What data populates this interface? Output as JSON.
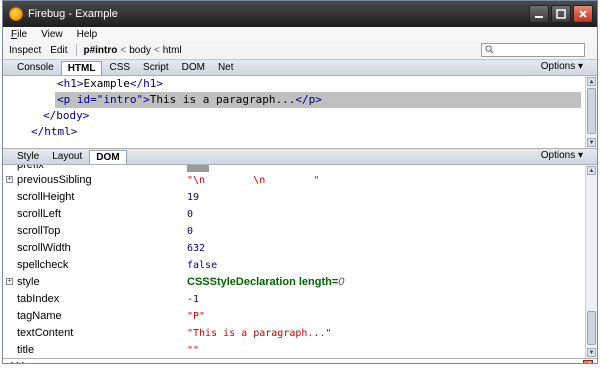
{
  "window": {
    "title": "Firebug - Example"
  },
  "menu": {
    "items": [
      {
        "label": "File",
        "accel": "F",
        "rest": "ile"
      },
      {
        "label": "View",
        "accel": "",
        "rest": "View"
      },
      {
        "label": "Help",
        "accel": "",
        "rest": "Help"
      }
    ]
  },
  "toolbar": {
    "inspect": "Inspect",
    "edit": "Edit",
    "breadcrumb": [
      "p#intro",
      "body",
      "html"
    ],
    "crumb_sep": "<"
  },
  "main_tabs": [
    "Console",
    "HTML",
    "CSS",
    "Script",
    "DOM",
    "Net"
  ],
  "main_active_tab": "HTML",
  "options_label": "Options ▾",
  "html_source": {
    "h1_open": "<h1>",
    "h1_text": "Example",
    "h1_close": "</h1>",
    "p_open": "<p id=\"intro\">",
    "p_text": "This is a paragraph...",
    "p_close": "</p>",
    "body_close": "</body>",
    "html_close": "</html>"
  },
  "side_tabs": [
    "Style",
    "Layout",
    "DOM"
  ],
  "side_active_tab": "DOM",
  "dom_rows": [
    {
      "name": "prefix",
      "value": "",
      "kind": "badge",
      "expandable": false
    },
    {
      "name": "previousSibling",
      "value": "\"\\n        \\n        \"",
      "kind": "str",
      "expandable": true
    },
    {
      "name": "scrollHeight",
      "value": "19",
      "kind": "num",
      "expandable": false
    },
    {
      "name": "scrollLeft",
      "value": "0",
      "kind": "num",
      "expandable": false
    },
    {
      "name": "scrollTop",
      "value": "0",
      "kind": "num",
      "expandable": false
    },
    {
      "name": "scrollWidth",
      "value": "632",
      "kind": "num",
      "expandable": false
    },
    {
      "name": "spellcheck",
      "value": "false",
      "kind": "bool",
      "expandable": false
    },
    {
      "name": "style",
      "value": "CSSStyleDeclaration length=",
      "count": "0",
      "kind": "obj",
      "expandable": true
    },
    {
      "name": "tabIndex",
      "value": "-1",
      "kind": "num",
      "expandable": false
    },
    {
      "name": "tagName",
      "value": "\"P\"",
      "kind": "str",
      "expandable": false
    },
    {
      "name": "textContent",
      "value": "\"This is a paragraph...\"",
      "kind": "str",
      "expandable": false
    },
    {
      "name": "title",
      "value": "\"\"",
      "kind": "str",
      "expandable": false
    }
  ],
  "command_line": {
    "prompt": ">>>"
  },
  "icons": {
    "logo": "firebug-logo-icon",
    "search": "search-icon"
  }
}
